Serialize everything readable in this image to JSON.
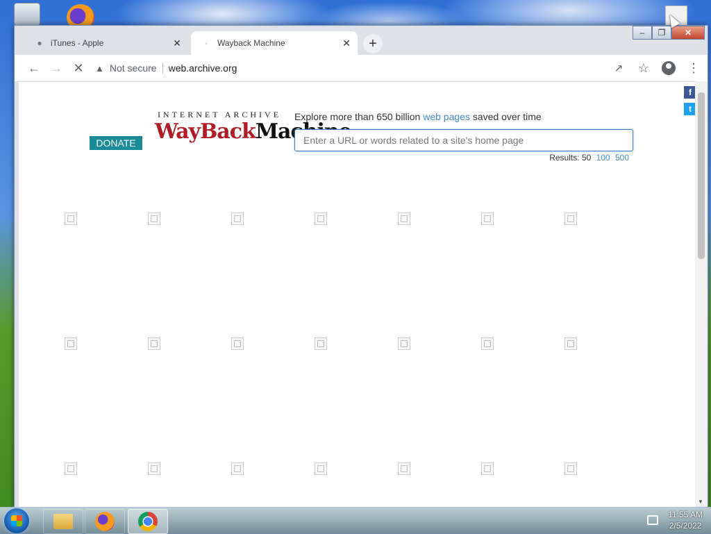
{
  "window": {
    "minimize": "–",
    "maximize": "❐",
    "close": "✕"
  },
  "tabs": [
    {
      "title": "iTunes - Apple",
      "favicon": "apple-icon",
      "close": "✕"
    },
    {
      "title": "Wayback Machine",
      "favicon": "loading-dot-icon",
      "close": "✕"
    }
  ],
  "toolbar": {
    "security_label": "Not secure",
    "url": "web.archive.org",
    "new_tab": "+"
  },
  "page": {
    "donate_label": "DONATE",
    "logo_top": "INTERNET ARCHIVE",
    "logo_wayback": "WayBack",
    "logo_machine": "Machine",
    "explore_prefix": "Explore more than 650 billion",
    "explore_link": "web pages",
    "explore_suffix": "saved over time",
    "search_placeholder": "Enter a URL or words related to a site's home page",
    "results_label": "Results: 50",
    "results_100": "100",
    "results_500": "500",
    "social_fb": "f",
    "social_tw": "t"
  },
  "taskbar": {
    "apps": [
      "Windows Explorer",
      "Firefox",
      "Google Chrome"
    ],
    "time": "11:55 AM",
    "date": "2/5/2022"
  },
  "colors": {
    "donate_bg": "#1a8a98",
    "wayback_red": "#b01b24",
    "link_blue": "#428bca"
  }
}
